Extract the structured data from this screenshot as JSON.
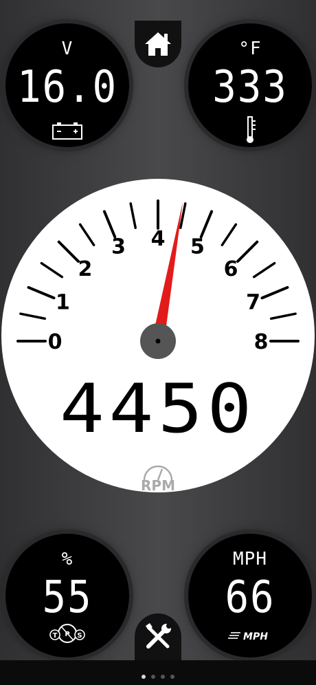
{
  "voltage": {
    "unit": "V",
    "value": "16.0",
    "icon": "battery-icon"
  },
  "temperature": {
    "unit": "°F",
    "value": "333",
    "icon": "thermometer-icon"
  },
  "tps": {
    "unit": "%",
    "value": "55",
    "icon": "tps-icon",
    "icon_text": [
      "T",
      "P",
      "S"
    ]
  },
  "speed": {
    "unit": "MPH",
    "value": "66",
    "icon": "speed-icon",
    "icon_text": "MPH"
  },
  "nav": {
    "home_icon": "home-icon",
    "tools_icon": "tools-icon"
  },
  "tachometer": {
    "labels": [
      "0",
      "1",
      "2",
      "3",
      "4",
      "5",
      "6",
      "7",
      "8"
    ],
    "needle_value": 4.45,
    "rpm": "4450",
    "logo_text": "RPM",
    "needle_color": "#e31b1b"
  },
  "pager": {
    "count": 4,
    "active": 0
  }
}
